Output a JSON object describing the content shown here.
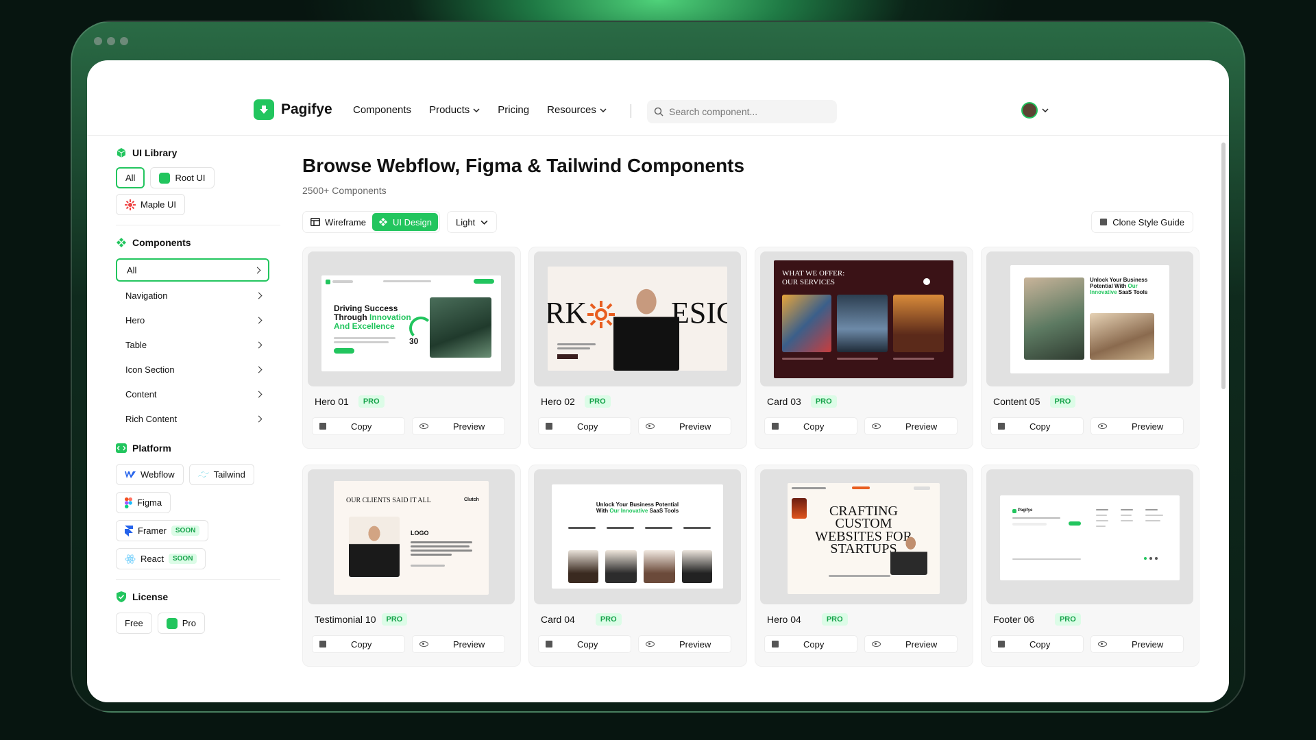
{
  "brand": {
    "name": "Pagifye",
    "accent": "#22c55e"
  },
  "nav": {
    "items": [
      {
        "label": "Components"
      },
      {
        "label": "Products"
      },
      {
        "label": "Pricing"
      },
      {
        "label": "Resources"
      }
    ]
  },
  "search": {
    "placeholder": "Search component..."
  },
  "sidebar": {
    "ui_library": {
      "title": "UI Library",
      "chips": [
        {
          "label": "All"
        },
        {
          "label": "Root UI"
        },
        {
          "label": "Maple UI"
        }
      ]
    },
    "components": {
      "title": "Components",
      "items": [
        {
          "label": "All"
        },
        {
          "label": "Navigation"
        },
        {
          "label": "Hero"
        },
        {
          "label": "Table"
        },
        {
          "label": "Icon Section"
        },
        {
          "label": "Content"
        },
        {
          "label": "Rich Content"
        }
      ]
    },
    "platform": {
      "title": "Platform",
      "chips": [
        {
          "label": "Webflow"
        },
        {
          "label": "Tailwind"
        },
        {
          "label": "Figma"
        },
        {
          "label": "Framer",
          "badge": "SOON"
        },
        {
          "label": "React",
          "badge": "SOON"
        }
      ]
    },
    "license": {
      "title": "License",
      "chips": [
        {
          "label": "Free"
        },
        {
          "label": "Pro"
        }
      ]
    }
  },
  "main": {
    "title": "Browse Webflow, Figma & Tailwind Components",
    "count": "2500+ Components",
    "view_toggle": [
      {
        "label": "Wireframe"
      },
      {
        "label": "UI Design"
      }
    ],
    "theme": "Light",
    "clone_label": "Clone Style Guide",
    "copy_label": "Copy",
    "preview_label": "Preview",
    "pro_label": "PRO",
    "cards": [
      {
        "name": "Hero 01",
        "thumb": {
          "headline_a": "Driving Success",
          "headline_b": "Through",
          "headline_hl": "Innovation",
          "headline_c": "And Excellence",
          "stat": "30"
        }
      },
      {
        "name": "Hero 02",
        "thumb": {
          "word_left": "RK",
          "word_right": "ESIG"
        }
      },
      {
        "name": "Card 03",
        "thumb": {
          "line1": "WHAT WE OFFER:",
          "line2": "OUR SERVICES"
        }
      },
      {
        "name": "Content 05",
        "thumb": {
          "line1": "Unlock Your Business",
          "line2": "Potential With",
          "hl": "Our",
          "line3": "Innovative",
          "line4": "SaaS Tools"
        }
      },
      {
        "name": "Testimonial 10",
        "thumb": {
          "heading": "OUR CLIENTS SAID IT ALL",
          "logo": "Clutch",
          "brand": "LOGO"
        }
      },
      {
        "name": "Card 04",
        "thumb": {
          "line1": "Unlock Your Business Potential",
          "line2": "With",
          "hl": "Our Innovative",
          "line3": "SaaS Tools"
        }
      },
      {
        "name": "Hero 04",
        "thumb": {
          "line1": "CRAFTING",
          "line2": "CUSTOM",
          "line3": "WEBSITES FOR",
          "line4": "STARTUPS"
        }
      },
      {
        "name": "Footer 06",
        "thumb": {
          "brand": "Pagifye"
        }
      }
    ]
  }
}
